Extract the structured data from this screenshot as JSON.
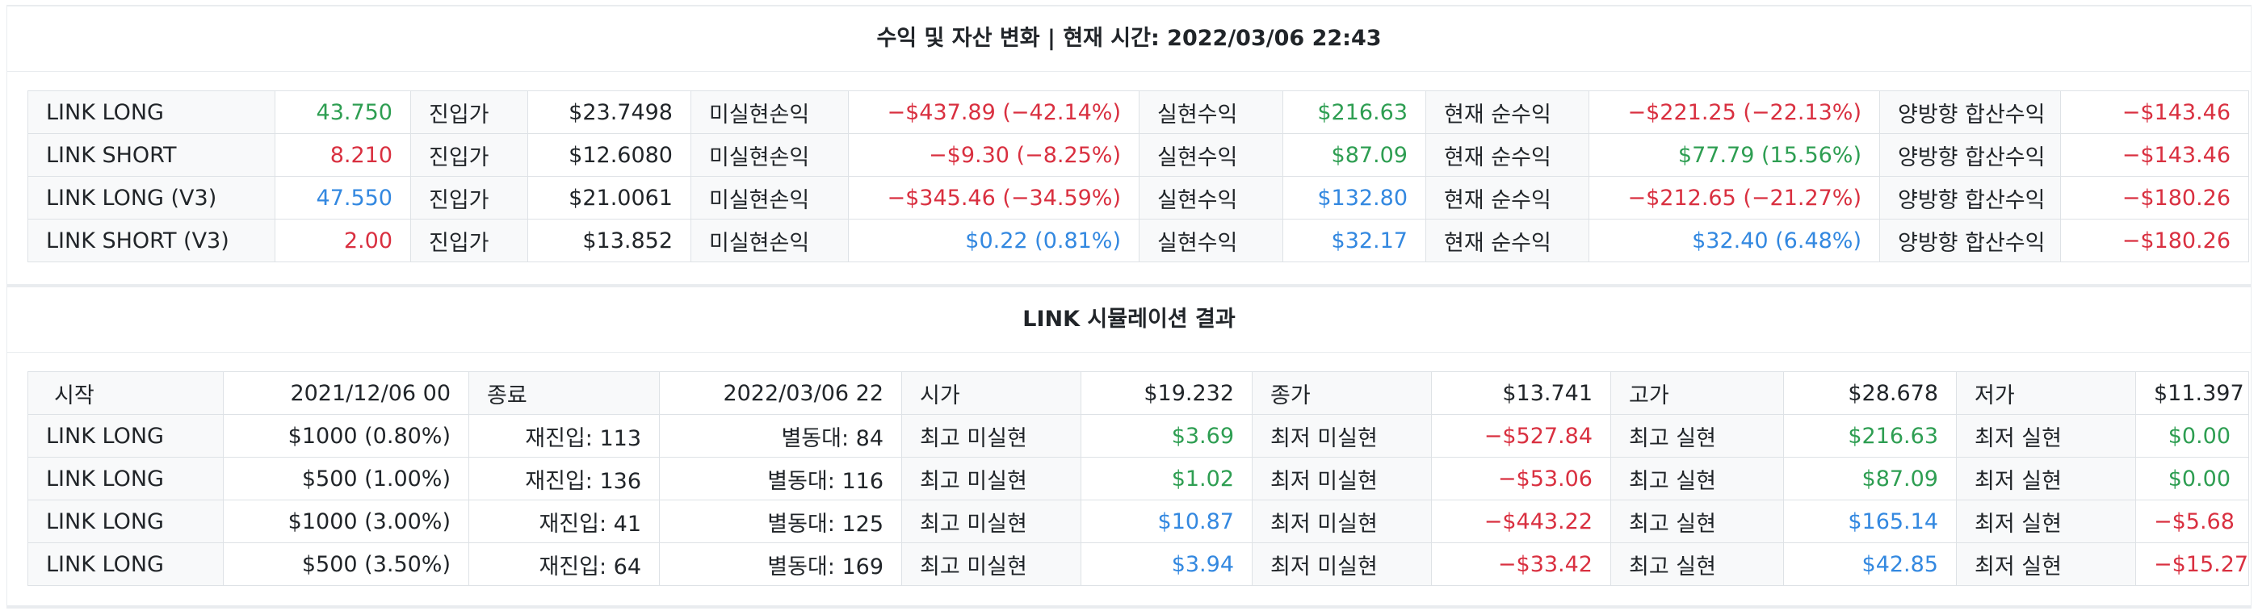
{
  "summary": {
    "title": "수익 및 자산 변화 | 현재 시간: 2022/03/06 22:43",
    "labels": {
      "entry": "진입가",
      "unrealized": "미실현손익",
      "realized": "실현수익",
      "net": "현재 순수익",
      "combined": "양방향 합산수익"
    },
    "rows": [
      {
        "name": "LINK LONG",
        "amount": "43.750",
        "amount_color": "green",
        "entry_price": "$23.7498",
        "unrealized": "−$437.89 (−42.14%)",
        "unrealized_color": "red",
        "realized": "$216.63",
        "realized_color": "green",
        "net": "−$221.25 (−22.13%)",
        "net_color": "red",
        "combined": "−$143.46",
        "combined_color": "red"
      },
      {
        "name": "LINK SHORT",
        "amount": "8.210",
        "amount_color": "red",
        "entry_price": "$12.6080",
        "unrealized": "−$9.30 (−8.25%)",
        "unrealized_color": "red",
        "realized": "$87.09",
        "realized_color": "green",
        "net": "$77.79 (15.56%)",
        "net_color": "green",
        "combined": "−$143.46",
        "combined_color": "red"
      },
      {
        "name": "LINK LONG (V3)",
        "amount": "47.550",
        "amount_color": "blue",
        "entry_price": "$21.0061",
        "unrealized": "−$345.46 (−34.59%)",
        "unrealized_color": "red",
        "realized": "$132.80",
        "realized_color": "blue",
        "net": "−$212.65 (−21.27%)",
        "net_color": "red",
        "combined": "−$180.26",
        "combined_color": "red"
      },
      {
        "name": "LINK SHORT (V3)",
        "amount": "2.00",
        "amount_color": "red",
        "entry_price": "$13.852",
        "unrealized": "$0.22 (0.81%)",
        "unrealized_color": "blue",
        "realized": "$32.17",
        "realized_color": "blue",
        "net": "$32.40 (6.48%)",
        "net_color": "blue",
        "combined": "−$180.26",
        "combined_color": "red"
      }
    ]
  },
  "simulation": {
    "title": "LINK 시뮬레이션 결과",
    "header": {
      "start_label": "시작",
      "start_value": "2021/12/06 00",
      "end_label": "종료",
      "end_value": "2022/03/06 22",
      "open_label": "시가",
      "open_value": "$19.232",
      "close_label": "종가",
      "close_value": "$13.741",
      "high_label": "고가",
      "high_value": "$28.678",
      "low_label": "저가",
      "low_value": "$11.397"
    },
    "labels": {
      "max_unrealized": "최고 미실현",
      "min_unrealized": "최저 미실현",
      "max_realized": "최고 실현",
      "min_realized": "최저 실현"
    },
    "rows": [
      {
        "name": "LINK LONG",
        "name_color": "green",
        "capital": "$1000 (0.80%)",
        "reentry": "재진입: 113",
        "volatility": "별동대: 84",
        "max_unrealized": "$3.69",
        "max_unrealized_color": "green",
        "min_unrealized": "−$527.84",
        "min_unrealized_color": "red",
        "max_realized": "$216.63",
        "max_realized_color": "green",
        "min_realized": "$0.00",
        "min_realized_color": "green"
      },
      {
        "name": "LINK LONG",
        "name_color": "red",
        "capital": "$500 (1.00%)",
        "reentry": "재진입: 136",
        "volatility": "별동대: 116",
        "max_unrealized": "$1.02",
        "max_unrealized_color": "green",
        "min_unrealized": "−$53.06",
        "min_unrealized_color": "red",
        "max_realized": "$87.09",
        "max_realized_color": "green",
        "min_realized": "$0.00",
        "min_realized_color": "green"
      },
      {
        "name": "LINK LONG",
        "name_color": "blue",
        "capital": "$1000 (3.00%)",
        "reentry": "재진입: 41",
        "volatility": "별동대: 125",
        "max_unrealized": "$10.87",
        "max_unrealized_color": "blue",
        "min_unrealized": "−$443.22",
        "min_unrealized_color": "red",
        "max_realized": "$165.14",
        "max_realized_color": "blue",
        "min_realized": "−$5.68",
        "min_realized_color": "red"
      },
      {
        "name": "LINK LONG",
        "name_color": "red",
        "capital": "$500 (3.50%)",
        "reentry": "재진입: 64",
        "volatility": "별동대: 169",
        "max_unrealized": "$3.94",
        "max_unrealized_color": "blue",
        "min_unrealized": "−$33.42",
        "min_unrealized_color": "red",
        "max_realized": "$42.85",
        "max_realized_color": "blue",
        "min_realized": "−$15.27",
        "min_realized_color": "red"
      }
    ]
  }
}
